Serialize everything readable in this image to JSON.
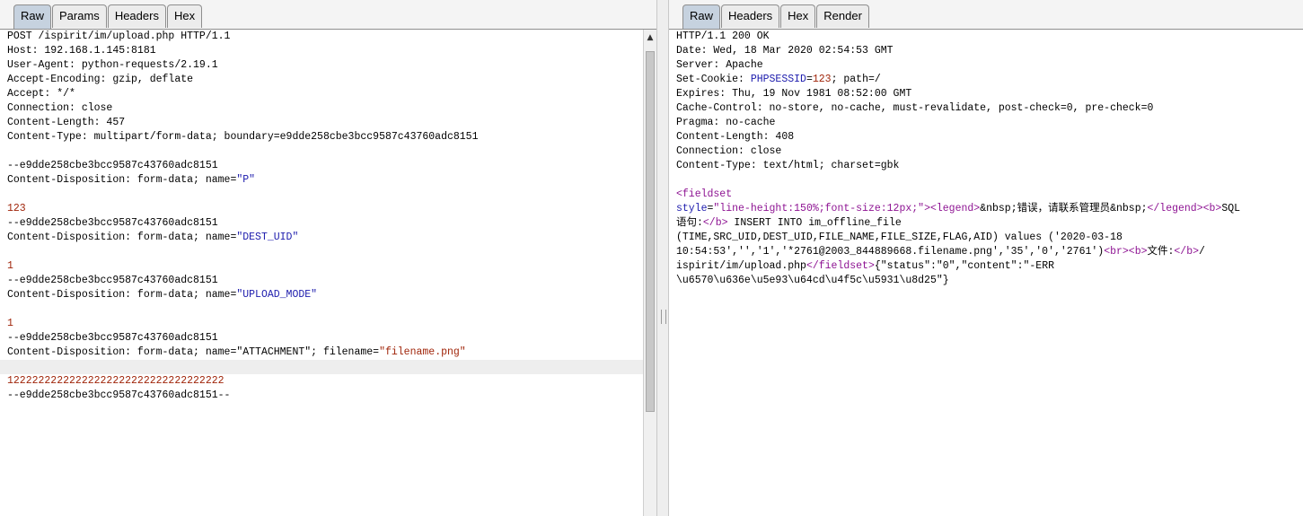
{
  "request": {
    "tabs": [
      "Raw",
      "Params",
      "Headers",
      "Hex"
    ],
    "active_tab": "Raw",
    "lines": [
      [
        [
          "k",
          "POST /ispirit/im/upload.php HTTP/1.1"
        ]
      ],
      [
        [
          "k",
          "Host: 192.168.1.145:8181"
        ]
      ],
      [
        [
          "k",
          "User-Agent: python-requests/2.19.1"
        ]
      ],
      [
        [
          "k",
          "Accept-Encoding: gzip, deflate"
        ]
      ],
      [
        [
          "k",
          "Accept: */*"
        ]
      ],
      [
        [
          "k",
          "Connection: close"
        ]
      ],
      [
        [
          "k",
          "Content-Length: 457"
        ]
      ],
      [
        [
          "k",
          "Content-Type: multipart/form-data; boundary=e9dde258cbe3bcc9587c43760adc8151"
        ]
      ],
      [],
      [
        [
          "k",
          "--e9dde258cbe3bcc9587c43760adc8151"
        ]
      ],
      [
        [
          "k",
          "Content-Disposition: form-data; name="
        ],
        [
          "v",
          "\"P\""
        ]
      ],
      [],
      [
        [
          "n",
          "123"
        ]
      ],
      [
        [
          "k",
          "--e9dde258cbe3bcc9587c43760adc8151"
        ]
      ],
      [
        [
          "k",
          "Content-Disposition: form-data; name="
        ],
        [
          "v",
          "\"DEST_UID\""
        ]
      ],
      [],
      [
        [
          "n",
          "1"
        ]
      ],
      [
        [
          "k",
          "--e9dde258cbe3bcc9587c43760adc8151"
        ]
      ],
      [
        [
          "k",
          "Content-Disposition: form-data; name="
        ],
        [
          "v",
          "\"UPLOAD_MODE\""
        ]
      ],
      [],
      [
        [
          "n",
          "1"
        ]
      ],
      [
        [
          "k",
          "--e9dde258cbe3bcc9587c43760adc8151"
        ]
      ],
      [
        [
          "k",
          "Content-Disposition: form-data; name=\"ATTACHMENT\"; filename="
        ],
        [
          "n",
          "\"filename.png\""
        ]
      ],
      [],
      [
        [
          "n",
          "12222222222222222222222222222222222"
        ]
      ],
      [
        [
          "k",
          "--e9dde258cbe3bcc9587c43760adc8151--"
        ]
      ]
    ],
    "highlighted_line": 23
  },
  "response": {
    "tabs": [
      "Raw",
      "Headers",
      "Hex",
      "Render"
    ],
    "active_tab": "Raw",
    "lines": [
      [
        [
          "k",
          "HTTP/1.1 200 OK"
        ]
      ],
      [
        [
          "k",
          "Date: Wed, 18 Mar 2020 02:54:53 GMT"
        ]
      ],
      [
        [
          "k",
          "Server: Apache"
        ]
      ],
      [
        [
          "k",
          "Set-Cookie: "
        ],
        [
          "v",
          "PHPSESSID"
        ],
        [
          "k",
          "="
        ],
        [
          "n",
          "123"
        ],
        [
          "k",
          "; path=/"
        ]
      ],
      [
        [
          "k",
          "Expires: Thu, 19 Nov 1981 08:52:00 GMT"
        ]
      ],
      [
        [
          "k",
          "Cache-Control: no-store, no-cache, must-revalidate, post-check=0, pre-check=0"
        ]
      ],
      [
        [
          "k",
          "Pragma: no-cache"
        ]
      ],
      [
        [
          "k",
          "Content-Length: 408"
        ]
      ],
      [
        [
          "k",
          "Connection: close"
        ]
      ],
      [
        [
          "k",
          "Content-Type: text/html; charset=gbk"
        ]
      ],
      [],
      [
        [
          "t",
          "<fieldset"
        ]
      ],
      [
        [
          "a",
          "style"
        ],
        [
          "k",
          "="
        ],
        [
          "t",
          "\"line-height:150%;font-size:12px;\""
        ],
        [
          "t",
          "><legend>"
        ],
        [
          "k",
          "&nbsp;错误，请联系管理员&nbsp;"
        ],
        [
          "t",
          "</legend><b>"
        ],
        [
          "k",
          "SQL"
        ]
      ],
      [
        [
          "k",
          "语句:"
        ],
        [
          "t",
          "</b>"
        ],
        [
          "k",
          " INSERT INTO im_offline_file"
        ]
      ],
      [
        [
          "k",
          "(TIME,SRC_UID,DEST_UID,FILE_NAME,FILE_SIZE,FLAG,AID) values ('2020-03-18"
        ]
      ],
      [
        [
          "k",
          "10:54:53','','1','*2761@2003_844889668.filename.png','35','0','2761')"
        ],
        [
          "t",
          "<br><b>"
        ],
        [
          "k",
          "文件:"
        ],
        [
          "t",
          "</b>"
        ],
        [
          "k",
          "/"
        ]
      ],
      [
        [
          "k",
          "ispirit/im/upload.php"
        ],
        [
          "t",
          "</fieldset>"
        ],
        [
          "k",
          "{\"status\":\"0\",\"content\":\"-ERR"
        ]
      ],
      [
        [
          "k",
          "\\u6570\\u636e\\u5e93\\u64cd\\u4f5c\\u5931\\u8d25\"}"
        ]
      ]
    ]
  }
}
